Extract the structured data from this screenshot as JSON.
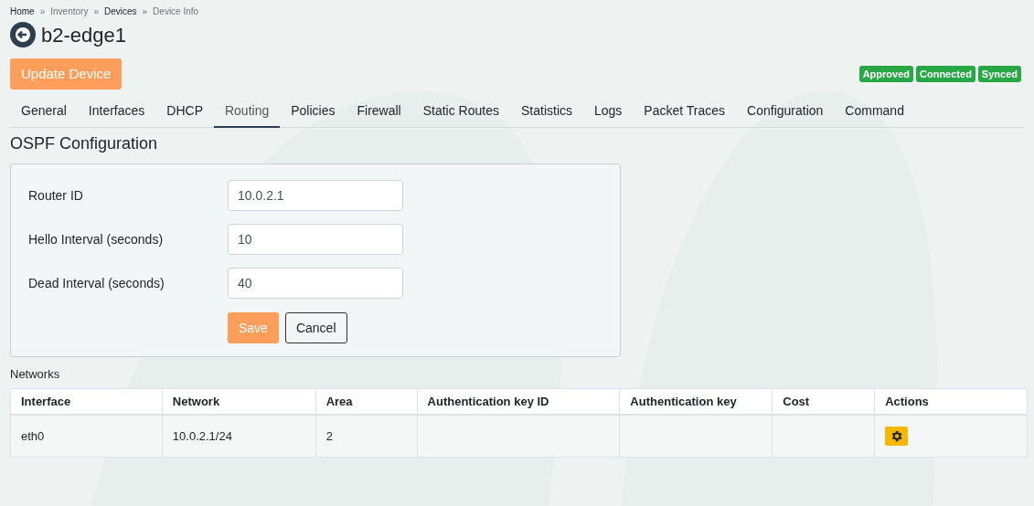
{
  "breadcrumb": [
    {
      "label": "Home",
      "link": true
    },
    {
      "label": "Inventory",
      "link": false
    },
    {
      "label": "Devices",
      "link": true
    },
    {
      "label": "Device Info",
      "link": false
    }
  ],
  "breadcrumb_separator": "»",
  "title": "b2-edge1",
  "update_button": "Update Device",
  "badges": [
    "Approved",
    "Connected",
    "Synced"
  ],
  "tabs": [
    {
      "label": "General",
      "selected": false
    },
    {
      "label": "Interfaces",
      "selected": false
    },
    {
      "label": "DHCP",
      "selected": false
    },
    {
      "label": "Routing",
      "selected": true
    },
    {
      "label": "Policies",
      "selected": false
    },
    {
      "label": "Firewall",
      "selected": false
    },
    {
      "label": "Static Routes",
      "selected": false
    },
    {
      "label": "Statistics",
      "selected": false
    },
    {
      "label": "Logs",
      "selected": false
    },
    {
      "label": "Packet Traces",
      "selected": false
    },
    {
      "label": "Configuration",
      "selected": false
    },
    {
      "label": "Command",
      "selected": false
    }
  ],
  "section_title": "OSPF Configuration",
  "form": {
    "fields": [
      {
        "label": "Router ID",
        "value": "10.0.2.1"
      },
      {
        "label": "Hello Interval (seconds)",
        "value": "10"
      },
      {
        "label": "Dead Interval (seconds)",
        "value": "40"
      }
    ],
    "save": "Save",
    "cancel": "Cancel"
  },
  "networks": {
    "title": "Networks",
    "columns": [
      "Interface",
      "Network",
      "Area",
      "Authentication key ID",
      "Authentication key",
      "Cost",
      "Actions"
    ],
    "rows": [
      {
        "cells": [
          "eth0",
          "10.0.2.1/24",
          "2",
          "",
          "",
          ""
        ],
        "kind": "settings"
      }
    ]
  }
}
